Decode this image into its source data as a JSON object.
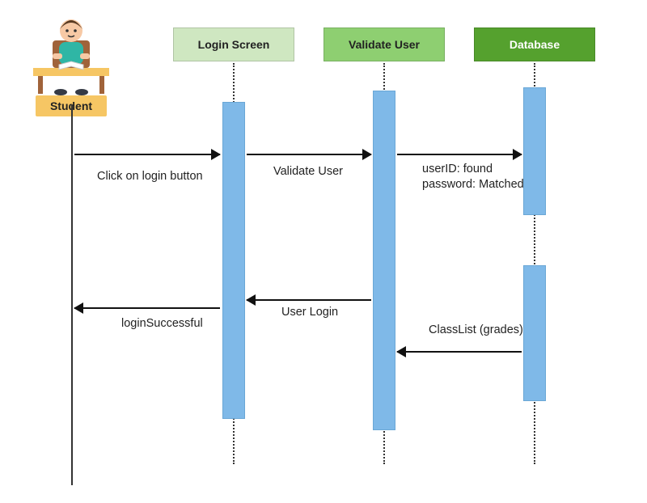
{
  "actors": {
    "student": "Student",
    "login_screen": "Login Screen",
    "validate_user": "Validate User",
    "database": "Database"
  },
  "messages": {
    "m1": "Click on login button",
    "m2": "Validate User",
    "m3": "userID: found\npassword: Matched",
    "m4": "User Login",
    "m5": "loginSuccessful",
    "m6": "ClassList (grades)"
  }
}
